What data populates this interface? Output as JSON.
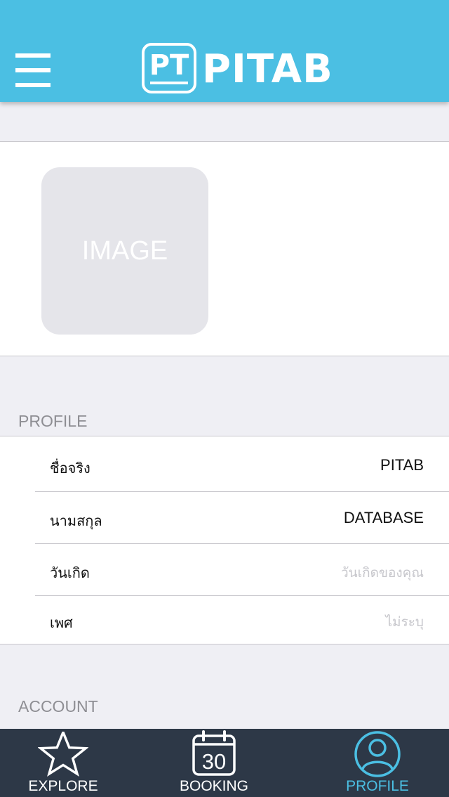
{
  "header": {
    "logo_mark_text": "PT",
    "logo_text": "PITAB",
    "menu_icon": "hamburger-icon"
  },
  "image": {
    "placeholder_text": "IMAGE"
  },
  "profile_section": {
    "title": "PROFILE",
    "rows": [
      {
        "label": "ชื่อจริง",
        "value": "PITAB",
        "is_placeholder": false
      },
      {
        "label": "นามสกุล",
        "value": "DATABASE",
        "is_placeholder": false
      },
      {
        "label": "วันเกิด",
        "value": "วันเกิดของคุณ",
        "is_placeholder": true
      },
      {
        "label": "เพศ",
        "value": "ไม่ระบุ",
        "is_placeholder": true
      }
    ]
  },
  "account_section": {
    "title": "ACCOUNT"
  },
  "tabbar": {
    "tabs": [
      {
        "label": "EXPLORE",
        "icon": "star-icon",
        "active": false
      },
      {
        "label": "BOOKING",
        "icon": "calendar-icon",
        "calendar_day": "30",
        "active": false
      },
      {
        "label": "PROFILE",
        "icon": "user-icon",
        "active": true
      }
    ]
  },
  "colors": {
    "header_bg": "#4bbfe3",
    "tabbar_bg": "#2d3847",
    "accent": "#4bbfe3",
    "page_bg": "#efeff4",
    "placeholder_text": "#c7c7cc"
  }
}
